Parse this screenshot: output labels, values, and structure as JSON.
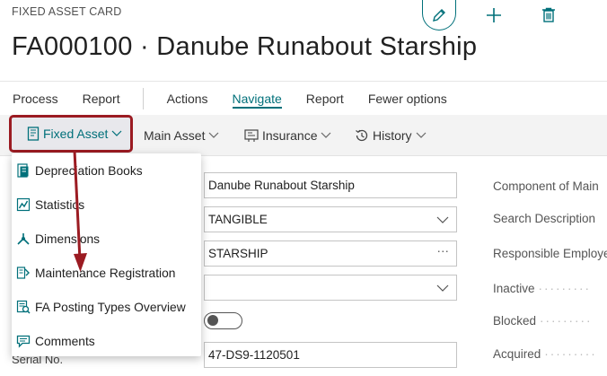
{
  "header": {
    "caption": "FIXED ASSET CARD",
    "title": "FA000100 · Danube Runabout Starship",
    "icons": [
      "edit-pencil-icon",
      "add-plus-icon",
      "delete-trash-icon"
    ]
  },
  "action_bar": {
    "items": [
      "Process",
      "Report",
      "Actions",
      "Navigate",
      "Report",
      "Fewer options"
    ],
    "active": "Navigate"
  },
  "sub_bar": {
    "fixed_asset": "Fixed Asset",
    "main_asset": "Main Asset",
    "insurance": "Insurance",
    "history": "History"
  },
  "dropdown": {
    "items": [
      {
        "label": "Depreciation Books",
        "icon": "depreciation-book-icon"
      },
      {
        "label": "Statistics",
        "icon": "statistics-chart-icon"
      },
      {
        "label": "Dimensions",
        "icon": "dimensions-icon"
      },
      {
        "label": "Maintenance Registration",
        "icon": "maintenance-icon"
      },
      {
        "label": "FA Posting Types Overview",
        "icon": "posting-overview-icon"
      },
      {
        "label": "Comments",
        "icon": "comment-icon"
      }
    ]
  },
  "form": {
    "description": "Danube Runabout Starship",
    "class_code": "TANGIBLE",
    "subclass_code": "STARSHIP",
    "location_code": "",
    "serial_label": "Serial No.",
    "serial_no": "47-DS9-1120501",
    "right_labels": {
      "component": "Component of Main",
      "search": "Search Description",
      "responsible": "Responsible Employe",
      "inactive": "Inactive",
      "blocked": "Blocked",
      "acquired": "Acquired"
    }
  },
  "colors": {
    "accent": "#00707a",
    "highlight_border": "#9b1b22",
    "annotation_arrow": "#9b1b22"
  }
}
